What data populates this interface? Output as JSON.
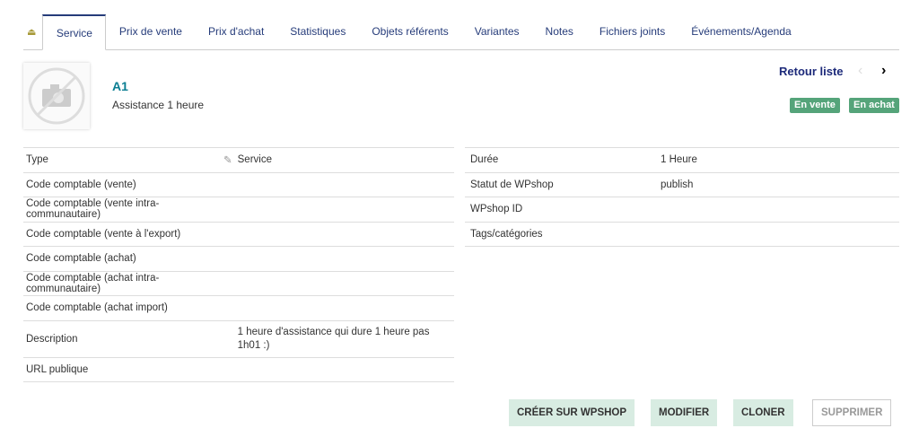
{
  "tabs": [
    "Service",
    "Prix de vente",
    "Prix d'achat",
    "Statistiques",
    "Objets référents",
    "Variantes",
    "Notes",
    "Fichiers joints",
    "Événements/Agenda"
  ],
  "product": {
    "ref": "A1",
    "label": "Assistance 1 heure"
  },
  "nav": {
    "back": "Retour liste",
    "prev": "‹",
    "next": "›"
  },
  "badges": [
    "En vente",
    "En achat"
  ],
  "left": [
    {
      "k": "Type",
      "v": "Service"
    },
    {
      "k": "Code comptable (vente)",
      "v": ""
    },
    {
      "k": "Code comptable (vente intra-communautaire)",
      "v": ""
    },
    {
      "k": "Code comptable (vente à l'export)",
      "v": ""
    },
    {
      "k": "Code comptable (achat)",
      "v": ""
    },
    {
      "k": "Code comptable (achat intra-communautaire)",
      "v": ""
    },
    {
      "k": "Code comptable (achat import)",
      "v": ""
    },
    {
      "k": "Description",
      "v": "1 heure d'assistance qui dure 1 heure pas 1h01 :)"
    },
    {
      "k": "URL publique",
      "v": ""
    }
  ],
  "right": [
    {
      "k": "Durée",
      "v": "1 Heure"
    },
    {
      "k": "Statut de WPshop",
      "v": "publish"
    },
    {
      "k": "WPshop ID",
      "v": ""
    },
    {
      "k": "Tags/catégories",
      "v": ""
    }
  ],
  "buttons": {
    "create": "CRÉER SUR WPSHOP",
    "modify": "MODIFIER",
    "clone": "CLONER",
    "delete": "SUPPRIMER"
  },
  "colors": {
    "accent": "#263c7a",
    "badge": "#55a47a",
    "button": "#d8ece2"
  }
}
